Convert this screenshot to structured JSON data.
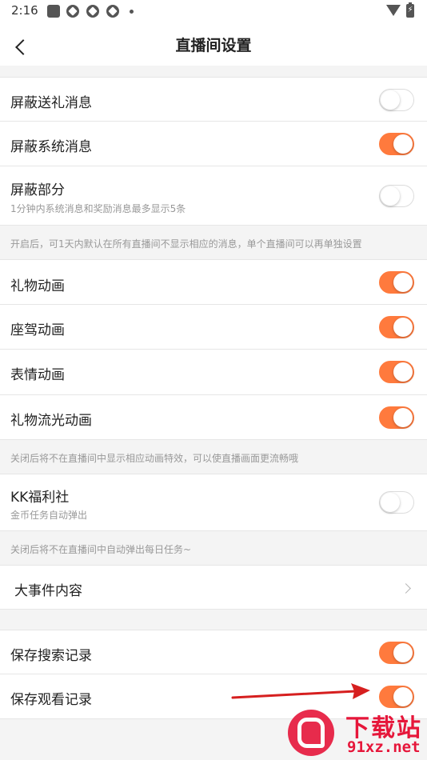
{
  "status_bar": {
    "time": "2:16"
  },
  "nav": {
    "title": "直播间设置"
  },
  "settings": {
    "block_gift": {
      "label": "屏蔽送礼消息",
      "enabled": false
    },
    "block_system": {
      "label": "屏蔽系统消息",
      "enabled": true
    },
    "block_partial": {
      "label": "屏蔽部分",
      "sub": "1分钟内系统消息和奖励消息最多显示5条",
      "enabled": false
    },
    "block_note": "开启后，可1天内默认在所有直播间不显示相应的消息，单个直播间可以再单独设置",
    "gift_animation": {
      "label": "礼物动画",
      "enabled": true
    },
    "mount_animation": {
      "label": "座驾动画",
      "enabled": true
    },
    "emoji_animation": {
      "label": "表情动画",
      "enabled": true
    },
    "gift_flow_animation": {
      "label": "礼物流光动画",
      "enabled": true
    },
    "animation_note": "关闭后将不在直播间中显示相应动画特效，可以使直播画面更流畅哦",
    "kk_welfare": {
      "label": "KK福利社",
      "sub": "金币任务自动弹出",
      "enabled": false
    },
    "welfare_note": "关闭后将不在直播间中自动弹出每日任务~",
    "major_events": {
      "label": "大事件内容"
    },
    "save_search": {
      "label": "保存搜索记录",
      "enabled": true
    },
    "save_watch": {
      "label": "保存观看记录",
      "enabled": true
    }
  },
  "colors": {
    "accent": "#ff7a3d",
    "annotation_arrow": "#d61f1f"
  },
  "watermark": {
    "top": "下载站",
    "bottom": "91xz.net"
  }
}
